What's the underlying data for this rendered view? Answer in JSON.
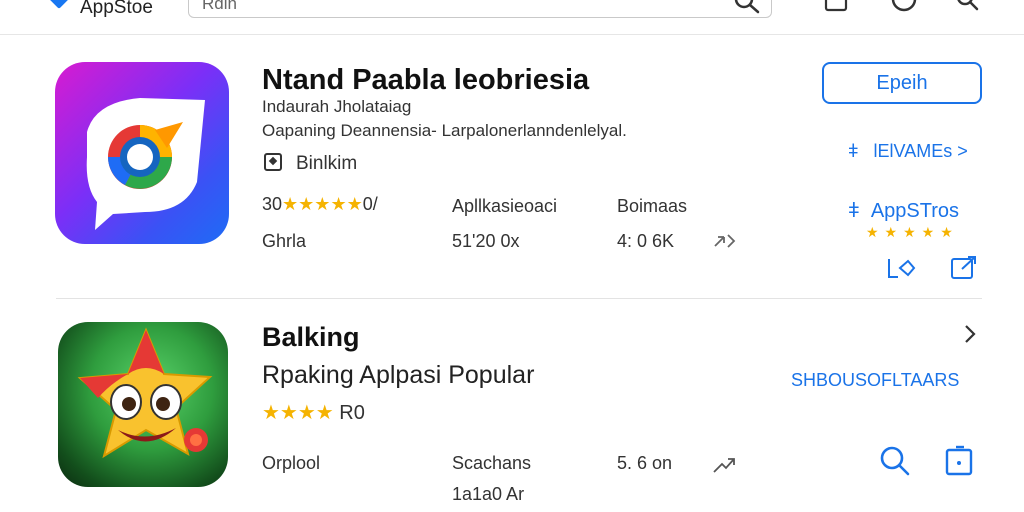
{
  "header": {
    "logo_text": "AppStoe",
    "search_placeholder": "Rdin"
  },
  "apps": [
    {
      "title": "Ntand Paabla leobriesia",
      "subtitle_1": "Indaurah Jholataiag",
      "subtitle_2": "Oapaning Deannensia- Larpalonerlanndenlelyal.",
      "badge_label": "Binlkim",
      "rating_prefix": "30",
      "rating_suffix": "0/",
      "stars": 4,
      "category_label": "Apllkasieoaci",
      "genre_label": "Boimaas",
      "row2_label": "Ghrla",
      "row2_value": "51'20 0x",
      "row2_size": "4: 0 6K",
      "open_button": "Epeih",
      "side_link_1": "lElVAMEs",
      "side_link_2": "AppSTros",
      "side_stars": 5
    },
    {
      "title": "Balking",
      "subtitle": "Rpaking Aplpasi Popular",
      "rating_suffix": "R0",
      "stars": 4,
      "row_label": "Orplool",
      "row_value": "Scachans",
      "row_value_2": "1a1a0 Ar",
      "row_size": "5. 6 on",
      "side_link": "SHBOUSOFLTAARS"
    }
  ],
  "colors": {
    "accent": "#1a73e8",
    "star": "#f5b301"
  }
}
